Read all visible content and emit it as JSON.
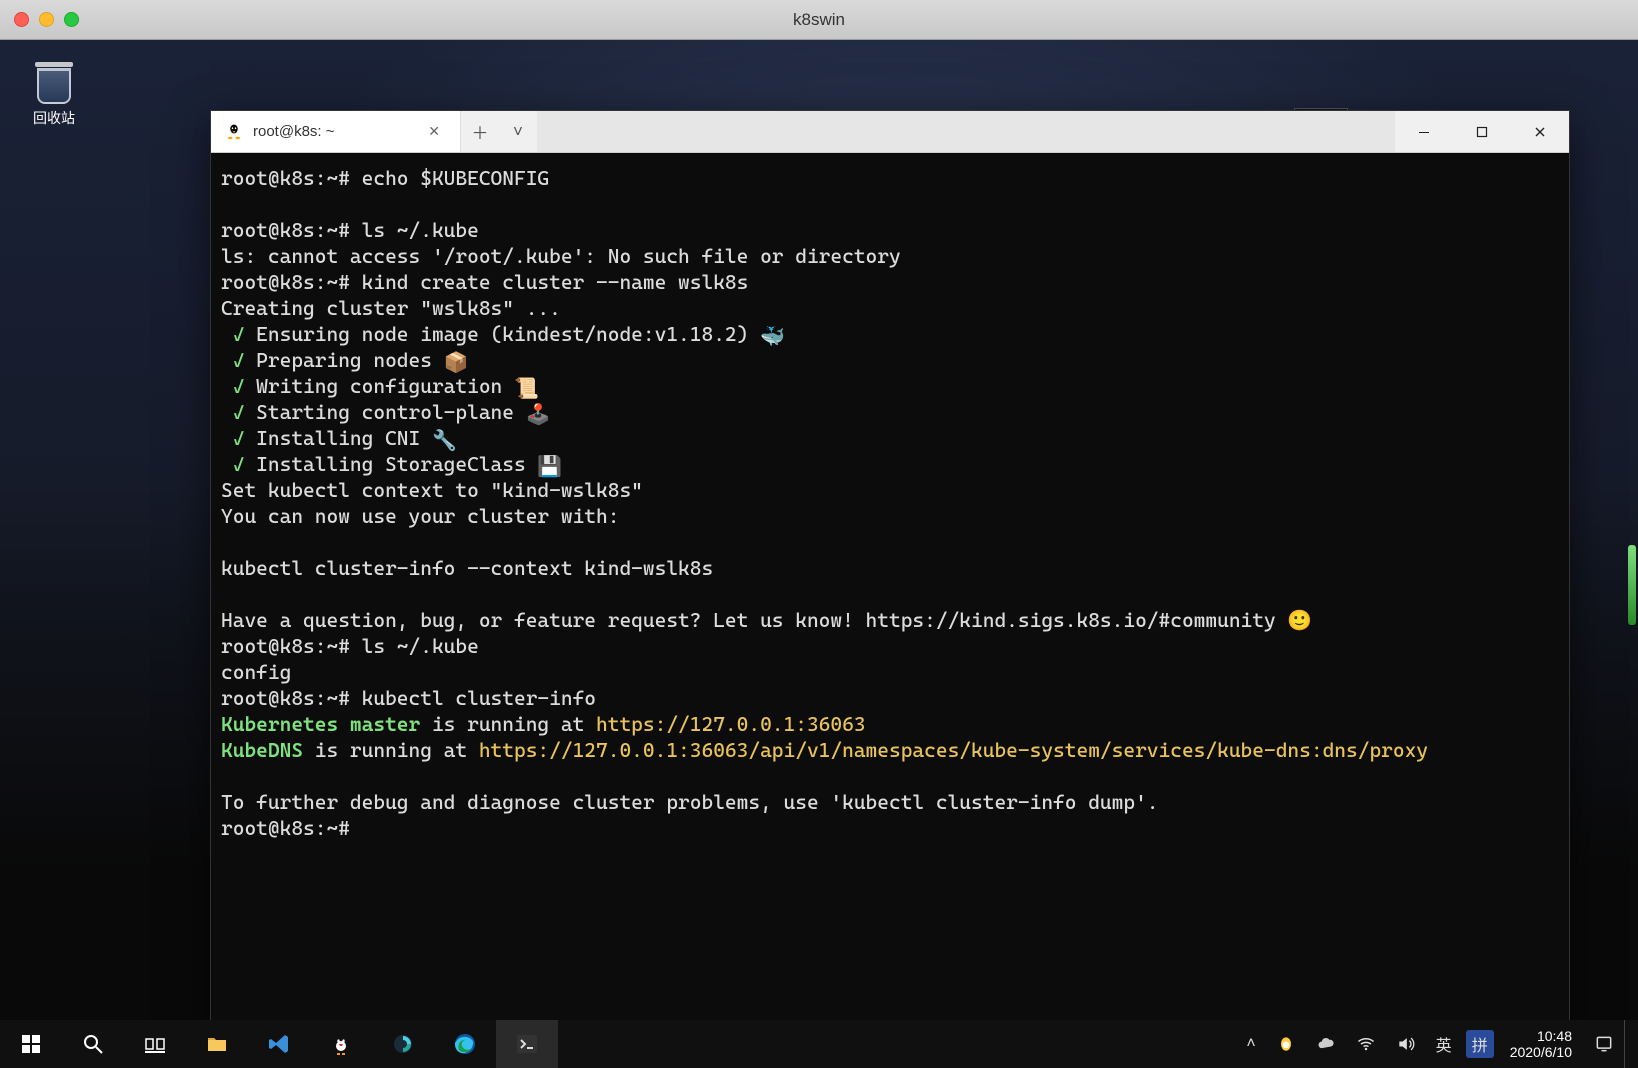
{
  "mac_titlebar": {
    "title": "k8swin"
  },
  "desktop": {
    "recycle_bin_label": "回收站"
  },
  "top_right_menu": {},
  "terminal": {
    "tab_label": "root@k8s: ~",
    "prompt": "root@k8s:~#",
    "lines": {
      "l01": "root@k8s:~# echo $KUBECONFIG",
      "l02": "",
      "l03": "root@k8s:~# ls ~/.kube",
      "l04": "ls: cannot access '/root/.kube': No such file or directory",
      "l05": "root@k8s:~# kind create cluster --name wslk8s",
      "l06": "Creating cluster \"wslk8s\" ...",
      "l07_text": "Ensuring node image (kindest/node:v1.18.2)",
      "l08_text": "Preparing nodes",
      "l09_text": "Writing configuration",
      "l10_text": "Starting control-plane",
      "l11_text": "Installing CNI",
      "l12_text": "Installing StorageClass",
      "l13": "Set kubectl context to \"kind-wslk8s\"",
      "l14": "You can now use your cluster with:",
      "l15": "",
      "l16": "kubectl cluster-info --context kind-wslk8s",
      "l17": "",
      "l18": "Have a question, bug, or feature request? Let us know! https://kind.sigs.k8s.io/#community 🙂",
      "l19": "root@k8s:~# ls ~/.kube",
      "l20": "config",
      "l21": "root@k8s:~# kubectl cluster-info",
      "l22a": "Kubernetes master",
      "l22b": " is running at ",
      "l22c": "https://127.0.0.1:36063",
      "l23a": "KubeDNS",
      "l23b": " is running at ",
      "l23c": "https://127.0.0.1:36063/api/v1/namespaces/kube-system/services/kube-dns:dns/proxy",
      "l24": "",
      "l25": "To further debug and diagnose cluster problems, use 'kubectl cluster-info dump'.",
      "l26": "root@k8s:~# "
    },
    "check": "✓",
    "emoji": {
      "whale": "🐳",
      "box": "📦",
      "scroll": "📜",
      "joy": "🕹️",
      "wrench": "🔧",
      "disk": "💾"
    }
  },
  "taskbar": {
    "icons": [
      "start",
      "search",
      "taskview",
      "explorer",
      "vscode",
      "qq",
      "browser1",
      "edge",
      "terminal"
    ],
    "tray": {
      "chevron": "˄",
      "icons": [
        "qq-tray",
        "cloud",
        "wifi",
        "sound"
      ],
      "ime1": "英",
      "ime2": "拼",
      "time": "10:48",
      "date": "2020/6/10"
    }
  }
}
